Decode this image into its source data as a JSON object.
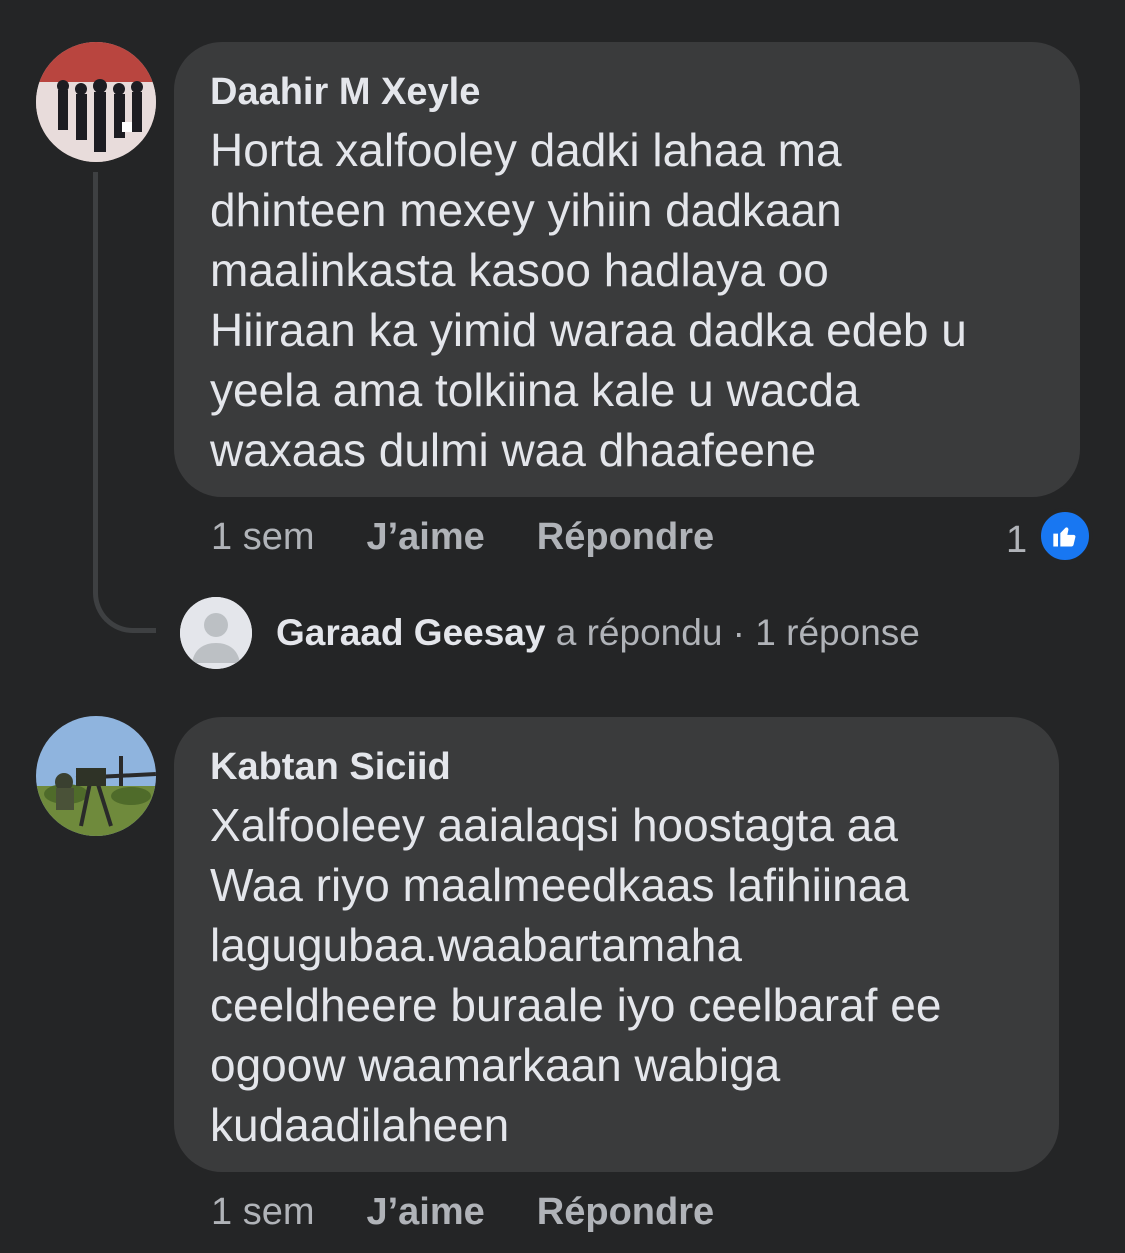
{
  "comments": [
    {
      "author": "Daahir M Xeyle",
      "text": "Horta xalfooley dadki lahaa ma\ndhinteen mexey  yihiin dadkaan\nmaalinkasta kasoo hadlaya oo\nHiiraan ka yimid waraa dadka edeb u\nyeela ama tolkiina kale u wacda\nwaxaas dulmi waa dhaafeene",
      "time": "1 sem",
      "like_label": "J’aime",
      "reply_label": "Répondre",
      "reaction_count": "1",
      "reaction_icon": "thumbs-up-icon",
      "reply_summary": {
        "name": "Garaad Geesay",
        "verb": " a répondu",
        "sep": " · ",
        "count": "1 réponse"
      }
    },
    {
      "author": "Kabtan Siciid",
      "text": "Xalfooleey aaialaqsi hoostagta aa\nWaa riyo maalmeedkaas lafihiinaa\nlagugubaa.waabartamaha\nceeldheere buraale iyo ceelbaraf ee\nogoow waamarkaan wabiga\nkudaadilaheen",
      "time": "1 sem",
      "like_label": "J’aime",
      "reply_label": "Répondre"
    }
  ],
  "colors": {
    "background": "#242526",
    "bubble": "#3a3b3c",
    "primary_text": "#e4e6eb",
    "secondary_text": "#b0b3b8",
    "like_blue": "#1877f2"
  }
}
